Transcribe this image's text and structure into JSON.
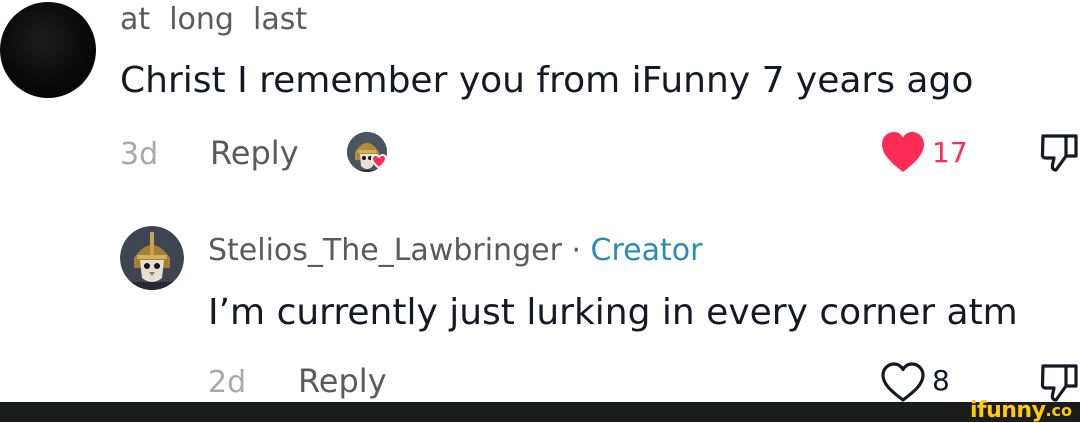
{
  "comment": {
    "username": "at  long  last",
    "text": "Christ I remember you from iFunny 7 years ago",
    "time": "3d",
    "reply_label": "Reply",
    "liked_by_creator_icon": "creator-avatar-with-heart",
    "like_count": "17",
    "liked": true,
    "like_color": "#fe2c55"
  },
  "reply": {
    "username": "Stelios_The_Lawbringer",
    "separator": "·",
    "badge": "Creator",
    "badge_color": "#2b8bb8",
    "text": "I’m currently just lurking in every corner atm",
    "time": "2d",
    "reply_label": "Reply",
    "like_count": "8",
    "liked": false
  },
  "watermark": {
    "text": "ifunny",
    "suffix": ".co"
  }
}
